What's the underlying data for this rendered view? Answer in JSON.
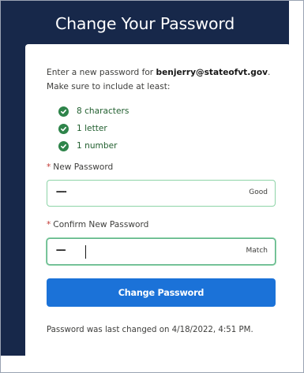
{
  "title": "Change Your Password",
  "intro": {
    "prefix": "Enter a new password for ",
    "email": "benjerry@stateofvt.gov",
    "suffix": ".",
    "line2": "Make sure to include at least:"
  },
  "requirements": [
    {
      "text": "8 characters",
      "icon": "check-circle-icon",
      "met": true
    },
    {
      "text": "1 letter",
      "icon": "check-circle-icon",
      "met": true
    },
    {
      "text": "1 number",
      "icon": "check-circle-icon",
      "met": true
    }
  ],
  "new_password": {
    "required_marker": "*",
    "label": "New Password",
    "masked_value": "···········",
    "strength": "Good"
  },
  "confirm_password": {
    "required_marker": "*",
    "label": "Confirm New Password",
    "masked_value": "··········",
    "status": "Match"
  },
  "submit_label": "Change Password",
  "footer": "Password was last changed on 4/18/2022, 4:51 PM.",
  "colors": {
    "header_bg": "#17284a",
    "button": "#1b72d8",
    "success": "#2e844a",
    "required": "#c23934"
  }
}
